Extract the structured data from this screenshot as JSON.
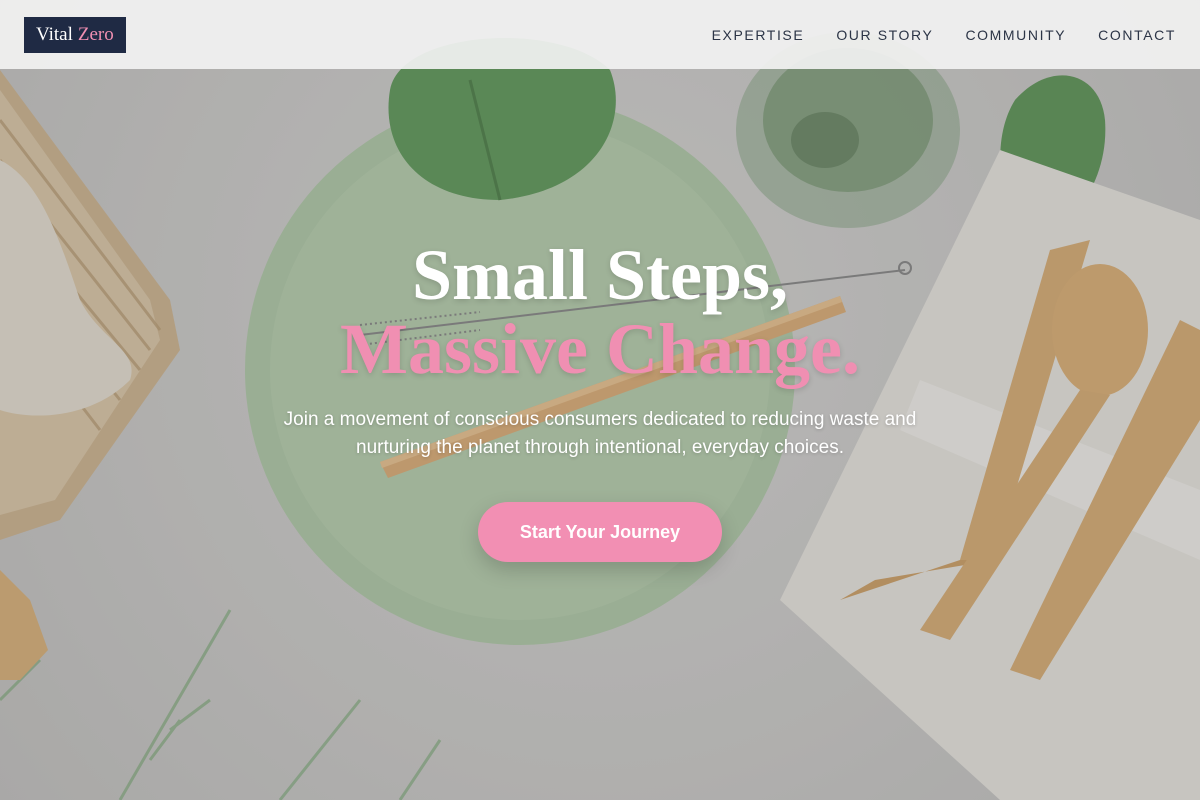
{
  "brand": {
    "name_part1": "Vital",
    "name_part2": "Zero",
    "accent_color": "#f08fb2",
    "logo_bg": "#1f2a44"
  },
  "nav": {
    "items": [
      {
        "label": "EXPERTISE"
      },
      {
        "label": "OUR STORY"
      },
      {
        "label": "COMMUNITY"
      },
      {
        "label": "CONTACT"
      }
    ]
  },
  "hero": {
    "title_line1": "Small Steps,",
    "title_line2": "Massive Change.",
    "subtitle": "Join a movement of conscious consumers dedicated to reducing waste and nurturing the planet through intentional, everyday choices.",
    "cta_label": "Start Your Journey",
    "cta_color": "#f28fb3",
    "background_description_icon": "eco-tableware-photo"
  }
}
